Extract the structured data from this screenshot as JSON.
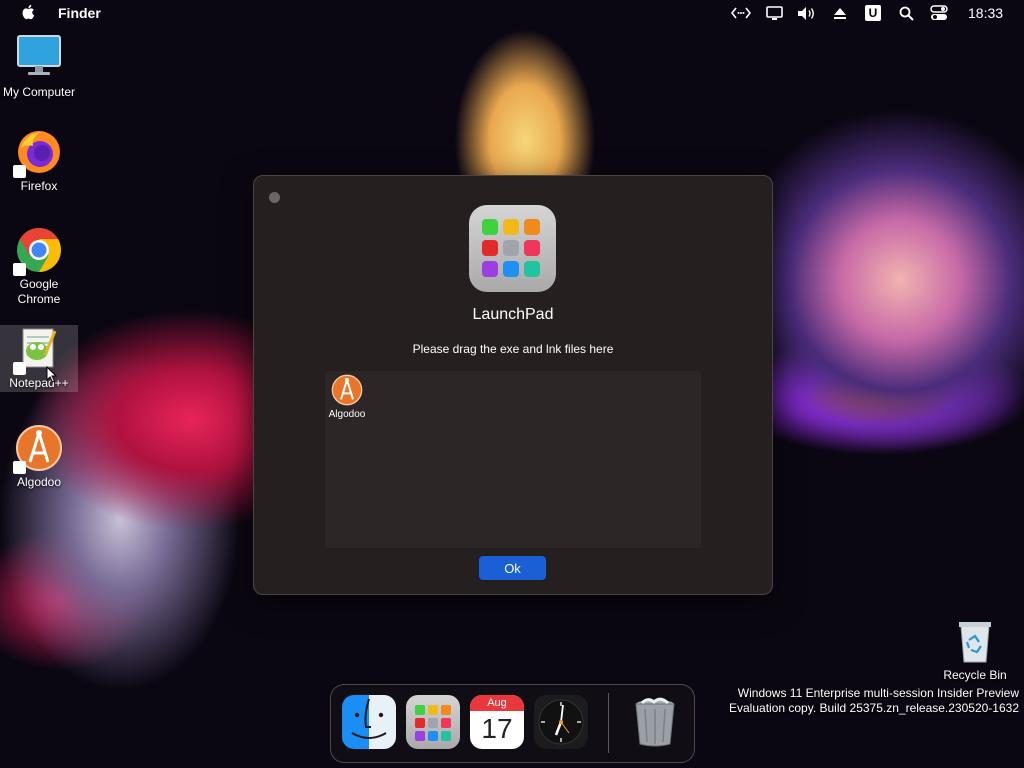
{
  "menubar": {
    "app_name": "Finder",
    "clock": "18:33",
    "status_icons": [
      "code-arrows-icon",
      "display-icon",
      "volume-icon",
      "eject-icon",
      "u-badge-icon",
      "search-icon",
      "control-center-icon"
    ],
    "u_badge": "U"
  },
  "desktop": {
    "icons": [
      {
        "label": "My Computer"
      },
      {
        "label": "Firefox"
      },
      {
        "label": "Google Chrome"
      },
      {
        "label": "Notepad++"
      },
      {
        "label": "Algodoo"
      }
    ],
    "recycle_bin": "Recycle Bin"
  },
  "dialog": {
    "title": "LaunchPad",
    "subtitle": "Please drag the exe and lnk files here",
    "dropped_files": [
      {
        "label": "Algodoo"
      }
    ],
    "ok_label": "Ok"
  },
  "dock": {
    "items": [
      "Finder",
      "LaunchPad",
      "Calendar",
      "Clock",
      "Trash"
    ],
    "calendar_month": "Aug",
    "calendar_day": "17"
  },
  "watermark": {
    "line1": "Windows 11 Enterprise multi-session Insider Preview",
    "line2": "Evaluation copy. Build 25375.zn_release.230520-1632"
  },
  "colors": {
    "accent": "#1a5fd4",
    "dialog_bg": "#251f1f"
  }
}
